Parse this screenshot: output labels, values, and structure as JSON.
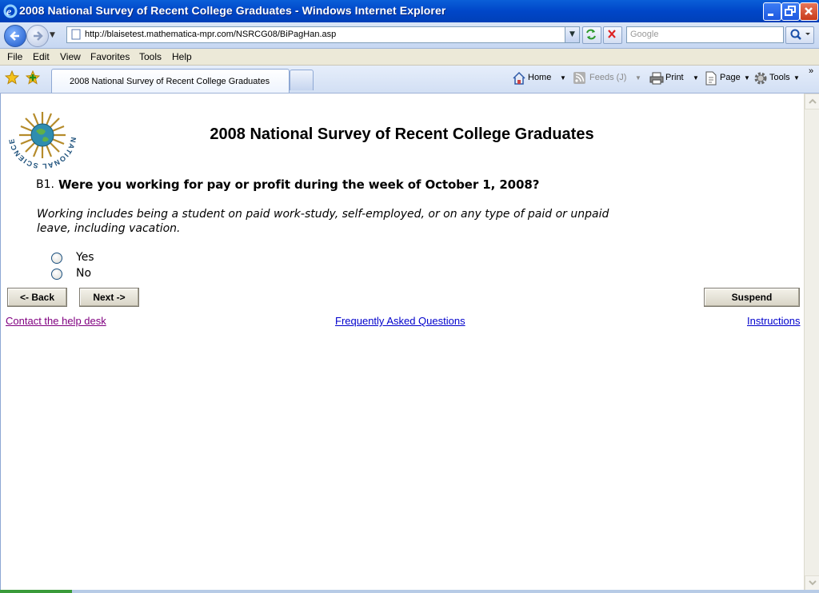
{
  "window": {
    "title": "2008 National Survey of Recent College Graduates - Windows Internet Explorer"
  },
  "browser": {
    "url": "http://blaisetest.mathematica-mpr.com/NSRCG08/BiPagHan.asp",
    "search_placeholder": "Google",
    "menu": [
      "File",
      "Edit",
      "View",
      "Favorites",
      "Tools",
      "Help"
    ],
    "tab_title": "2008 National Survey of Recent College Graduates",
    "commands": {
      "home": "Home",
      "feeds": "Feeds (J)",
      "print": "Print",
      "page": "Page",
      "tools": "Tools"
    }
  },
  "page": {
    "logo_text": "NATIONAL SCIENCE FOUNDATION",
    "title": "2008 National Survey of Recent College Graduates",
    "question_number": "B1.",
    "question_text": "Were you working for pay or profit during the week of October 1, 2008?",
    "note": "Working includes being a student on paid work-study, self-employed, or on any type of paid or unpaid leave, including vacation.",
    "options": [
      "Yes",
      "No"
    ],
    "buttons": {
      "back": "<- Back",
      "next": "Next ->",
      "suspend": "Suspend"
    },
    "links": {
      "help_desk": "Contact the help desk",
      "faq": "Frequently Asked Questions",
      "instructions": "Instructions"
    }
  },
  "colors": {
    "titlebar": "#0046c8",
    "link_visited": "#800080",
    "link": "#0000cc"
  }
}
